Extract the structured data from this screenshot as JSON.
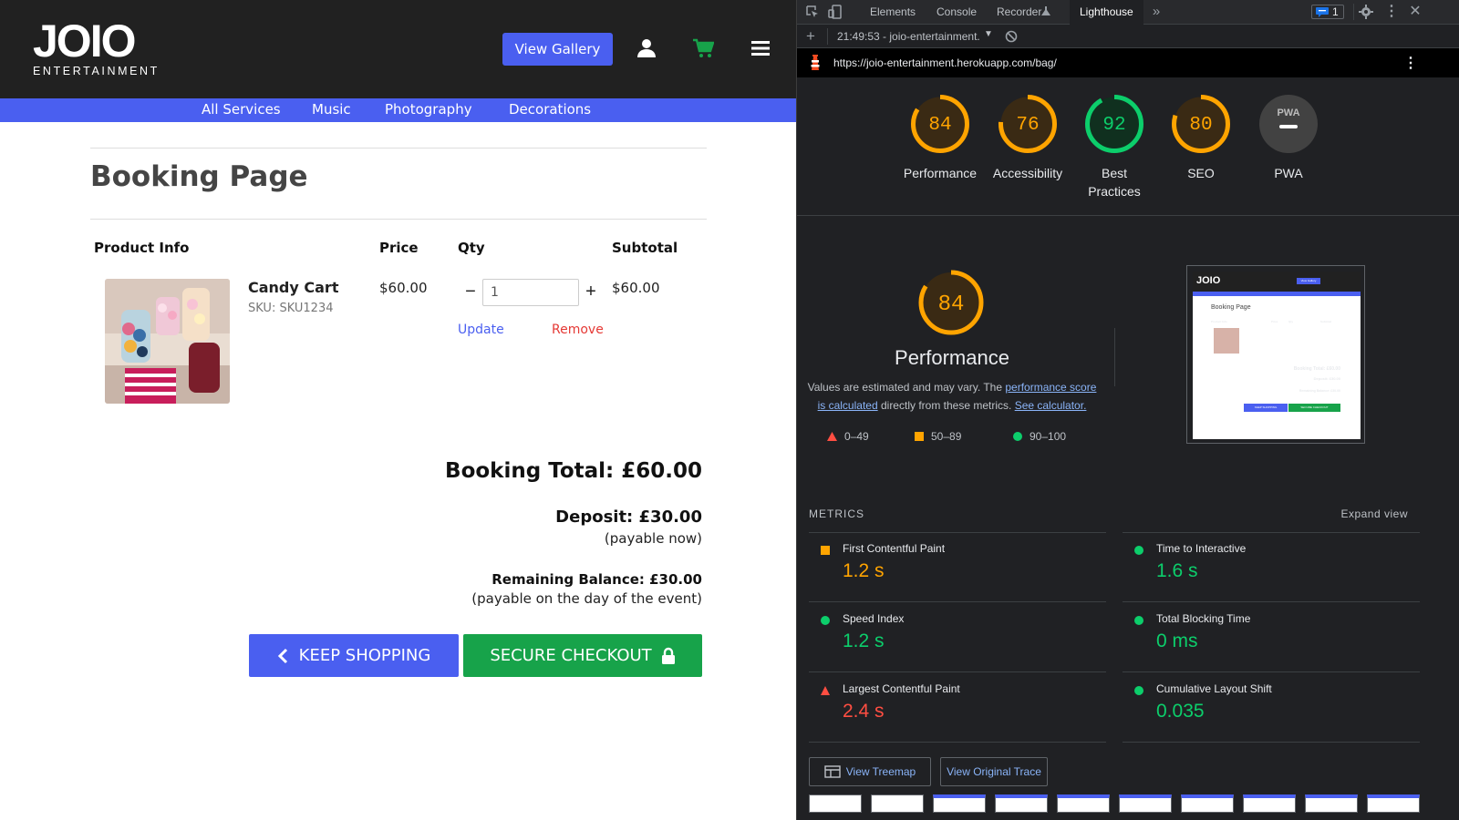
{
  "site": {
    "logo": {
      "main": "JOIO",
      "sub": "ENTERTAINMENT"
    },
    "header": {
      "gallery_button": "View Gallery",
      "icons": [
        "user-icon",
        "cart-icon",
        "hamburger-icon"
      ]
    },
    "nav": [
      "All Services",
      "Music",
      "Photography",
      "Decorations"
    ],
    "page_title": "Booking Page",
    "table": {
      "headers": [
        "Product Info",
        "Price",
        "Qty",
        "Subtotal"
      ],
      "item": {
        "name": "Candy Cart",
        "sku": "SKU: SKU1234",
        "price": "$60.00",
        "qty": "1",
        "subtotal": "$60.00",
        "update": "Update",
        "remove": "Remove"
      }
    },
    "totals": {
      "booking_total": "Booking Total: £60.00",
      "deposit": "Deposit: £30.00",
      "deposit_note": "(payable now)",
      "remaining": "Remaining Balance: £30.00",
      "remaining_note": "(payable on the day of the event)"
    },
    "buttons": {
      "keep_shopping": "KEEP SHOPPING",
      "checkout": "SECURE CHECKOUT"
    },
    "colors": {
      "brand_blue": "#4a5ff0",
      "checkout_green": "#17a34a",
      "remove_red": "#e53935"
    }
  },
  "devtools": {
    "tabs": [
      "Elements",
      "Console",
      "Recorder",
      "Lighthouse"
    ],
    "active_tab": "Lighthouse",
    "issues_count": "1",
    "report_select": "21:49:53 - joio-entertainment.",
    "url": "https://joio-entertainment.herokuapp.com/bag/",
    "scores": [
      {
        "label": "Performance",
        "value": 84,
        "color": "#ffa400"
      },
      {
        "label": "Accessibility",
        "value": 76,
        "color": "#ffa400"
      },
      {
        "label": "Best Practices",
        "value": 92,
        "color": "#0cce6b"
      },
      {
        "label": "SEO",
        "value": 80,
        "color": "#ffa400"
      },
      {
        "label": "PWA",
        "value": null,
        "color": "#9aa0a6"
      }
    ],
    "pwa_badge": "PWA",
    "perf": {
      "score": "84",
      "title": "Performance",
      "desc_pre": "Values are estimated and may vary. The ",
      "desc_link1": "performance score is calculated",
      "desc_mid": " directly from these metrics. ",
      "desc_link2": "See calculator.",
      "legend": [
        "0–49",
        "50–89",
        "90–100"
      ]
    },
    "metrics_heading": "METRICS",
    "expand_view": "Expand view",
    "metrics": [
      {
        "name": "First Contentful Paint",
        "value": "1.2 s",
        "status": "average"
      },
      {
        "name": "Time to Interactive",
        "value": "1.6 s",
        "status": "pass"
      },
      {
        "name": "Speed Index",
        "value": "1.2 s",
        "status": "pass"
      },
      {
        "name": "Total Blocking Time",
        "value": "0 ms",
        "status": "pass"
      },
      {
        "name": "Largest Contentful Paint",
        "value": "2.4 s",
        "status": "fail"
      },
      {
        "name": "Cumulative Layout Shift",
        "value": "0.035",
        "status": "pass"
      }
    ],
    "buttons": {
      "treemap": "View Treemap",
      "trace": "View Original Trace"
    },
    "status_colors": {
      "pass": "#0cce6b",
      "average": "#ffa400",
      "fail": "#ff4e42"
    },
    "thumb": {
      "logo": "JOIO",
      "gallery": "View Gallery",
      "title": "Booking Page",
      "headers": [
        "Product Info",
        "Price",
        "Qty",
        "Subtotal"
      ],
      "total": "Booking Total: £60.00",
      "deposit": "Deposit: £30.00",
      "remaining": "Remaining Balance: £30.00",
      "keep": "KEEP SHOPPING",
      "checkout": "SECURE CHECKOUT"
    }
  }
}
